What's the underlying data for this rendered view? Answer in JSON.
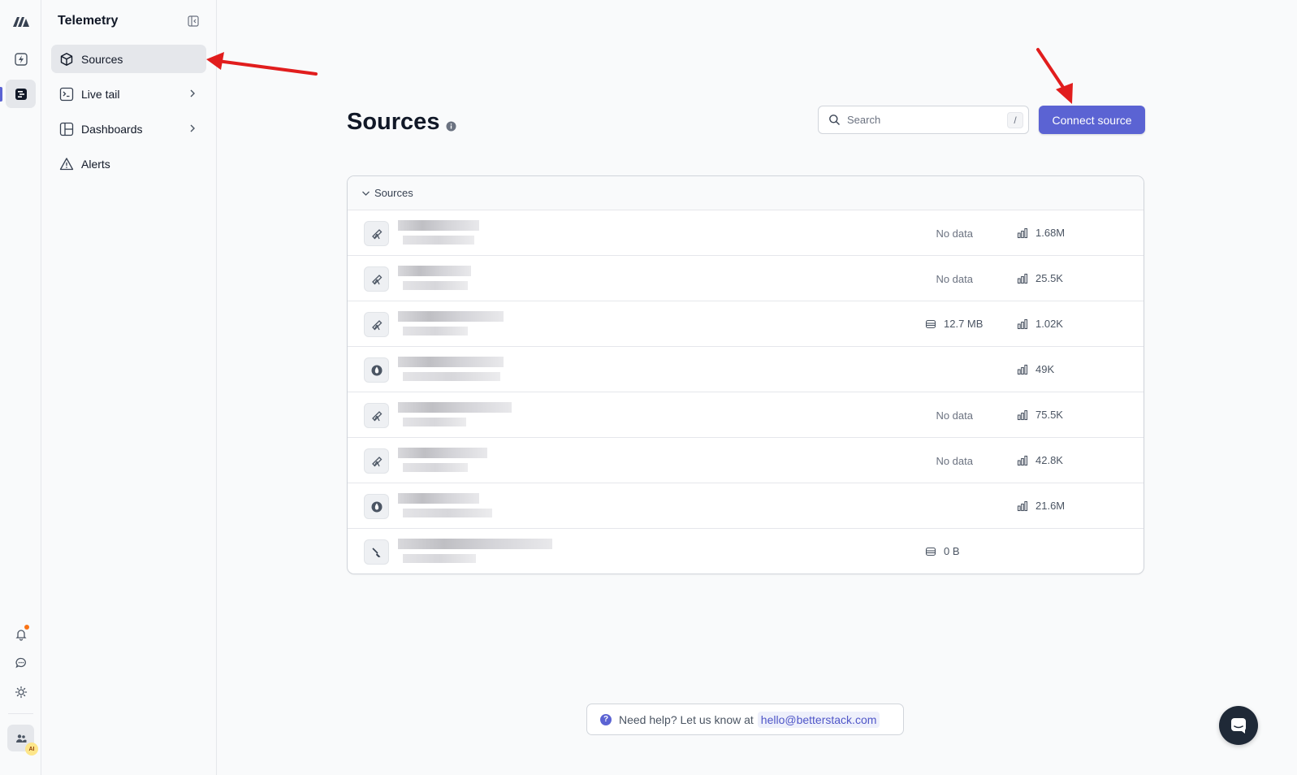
{
  "rail": {
    "items": [
      "logo-icon",
      "bolt-icon",
      "telemetry-icon"
    ],
    "bottom": [
      "bell-icon",
      "chat-icon",
      "sun-icon",
      "team-icon"
    ],
    "ai_badge": "AI"
  },
  "sidebar": {
    "title": "Telemetry",
    "items": [
      {
        "label": "Sources",
        "icon": "cube-icon",
        "active": true
      },
      {
        "label": "Live tail",
        "icon": "terminal-icon",
        "chevron": true
      },
      {
        "label": "Dashboards",
        "icon": "grid-icon",
        "chevron": true
      },
      {
        "label": "Alerts",
        "icon": "warning-icon"
      }
    ]
  },
  "header": {
    "title": "Sources",
    "search_placeholder": "Search",
    "search_shortcut": "/",
    "connect_label": "Connect source"
  },
  "table": {
    "group_label": "Sources",
    "rows": [
      {
        "icon": "telescope-icon",
        "status": "No data",
        "size": "",
        "count": "1.68M"
      },
      {
        "icon": "telescope-icon",
        "status": "No data",
        "size": "",
        "count": "25.5K"
      },
      {
        "icon": "telescope-icon",
        "status": "",
        "size": "12.7 MB",
        "count": "1.02K"
      },
      {
        "icon": "elixir-icon",
        "status": "",
        "size": "",
        "count": "49K"
      },
      {
        "icon": "telescope-icon",
        "status": "No data",
        "size": "",
        "count": "75.5K"
      },
      {
        "icon": "telescope-icon",
        "status": "No data",
        "size": "",
        "count": "42.8K"
      },
      {
        "icon": "elixir-icon",
        "status": "",
        "size": "",
        "count": "21.6M"
      },
      {
        "icon": "broom-icon",
        "status": "",
        "size": "0 B",
        "count": ""
      }
    ]
  },
  "help": {
    "text": "Need help? Let us know at",
    "email": "hello@betterstack.com"
  },
  "colors": {
    "accent": "#5b63d3",
    "annotation": "#e11d1d"
  }
}
